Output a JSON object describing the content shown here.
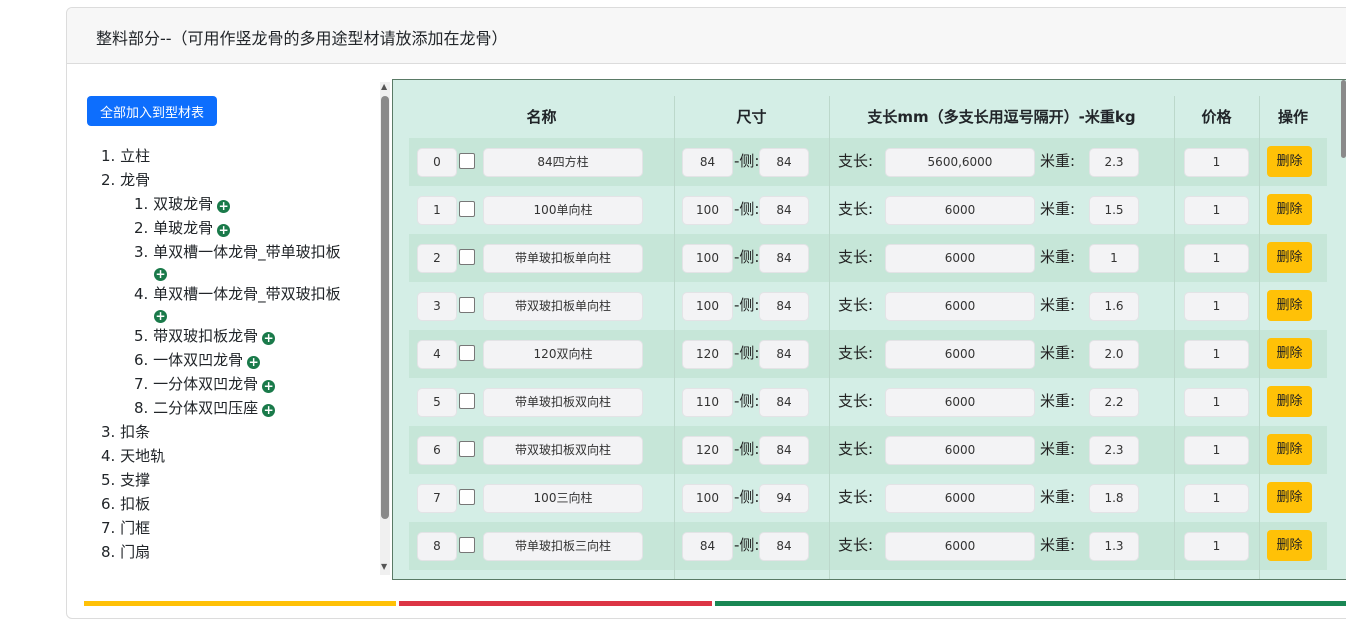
{
  "header": {
    "title": "整料部分--（可用作竖龙骨的多用途型材请放添加在龙骨）"
  },
  "left": {
    "add_all_button": "全部加入到型材表",
    "tree": [
      {
        "label": "1. 立柱"
      },
      {
        "label": "2. 龙骨"
      },
      {
        "label": "1. 双玻龙骨",
        "sub": true,
        "plus": true
      },
      {
        "label": "2. 单玻龙骨",
        "sub": true,
        "plus": true
      },
      {
        "label": "3. 单双槽一体龙骨_带单玻扣板",
        "sub": true,
        "plus_wrap": true
      },
      {
        "label": "4. 单双槽一体龙骨_带双玻扣板",
        "sub": true,
        "plus_wrap": true
      },
      {
        "label": "5. 带双玻扣板龙骨",
        "sub": true,
        "plus": true
      },
      {
        "label": "6. 一体双凹龙骨",
        "sub": true,
        "plus": true
      },
      {
        "label": "7. 一分体双凹龙骨",
        "sub": true,
        "plus": true
      },
      {
        "label": "8. 二分体双凹压座",
        "sub": true,
        "plus": true
      },
      {
        "label": "3. 扣条"
      },
      {
        "label": "4. 天地轨"
      },
      {
        "label": "5. 支撑"
      },
      {
        "label": "6. 扣板"
      },
      {
        "label": "7. 门框"
      },
      {
        "label": "8. 门扇"
      }
    ]
  },
  "table": {
    "columns": [
      "名称",
      "尺寸",
      "支长mm（多支长用逗号隔开）-米重kg",
      "价格",
      "操作"
    ],
    "side_label": "-侧:",
    "length_label": "支长:",
    "weight_label": "米重:",
    "delete_label": "删除",
    "rows": [
      {
        "idx": "0",
        "name": "84四方柱",
        "size": "84",
        "side": "84",
        "length": "5600,6000",
        "weight": "2.3",
        "price": "1"
      },
      {
        "idx": "1",
        "name": "100单向柱",
        "size": "100",
        "side": "84",
        "length": "6000",
        "weight": "1.5",
        "price": "1"
      },
      {
        "idx": "2",
        "name": "带单玻扣板单向柱",
        "size": "100",
        "side": "84",
        "length": "6000",
        "weight": "1",
        "price": "1"
      },
      {
        "idx": "3",
        "name": "带双玻扣板单向柱",
        "size": "100",
        "side": "84",
        "length": "6000",
        "weight": "1.6",
        "price": "1"
      },
      {
        "idx": "4",
        "name": "120双向柱",
        "size": "120",
        "side": "84",
        "length": "6000",
        "weight": "2.0",
        "price": "1"
      },
      {
        "idx": "5",
        "name": "带单玻扣板双向柱",
        "size": "110",
        "side": "84",
        "length": "6000",
        "weight": "2.2",
        "price": "1"
      },
      {
        "idx": "6",
        "name": "带双玻扣板双向柱",
        "size": "120",
        "side": "84",
        "length": "6000",
        "weight": "2.3",
        "price": "1"
      },
      {
        "idx": "7",
        "name": "100三向柱",
        "size": "100",
        "side": "94",
        "length": "6000",
        "weight": "1.8",
        "price": "1"
      },
      {
        "idx": "8",
        "name": "带单玻扣板三向柱",
        "size": "84",
        "side": "84",
        "length": "6000",
        "weight": "1.3",
        "price": "1"
      }
    ]
  },
  "colors": {
    "primary": "#0d6efd",
    "warning": "#ffc107",
    "table_bg": "#d4eee6",
    "plus_icon": "#1a7a4a"
  }
}
